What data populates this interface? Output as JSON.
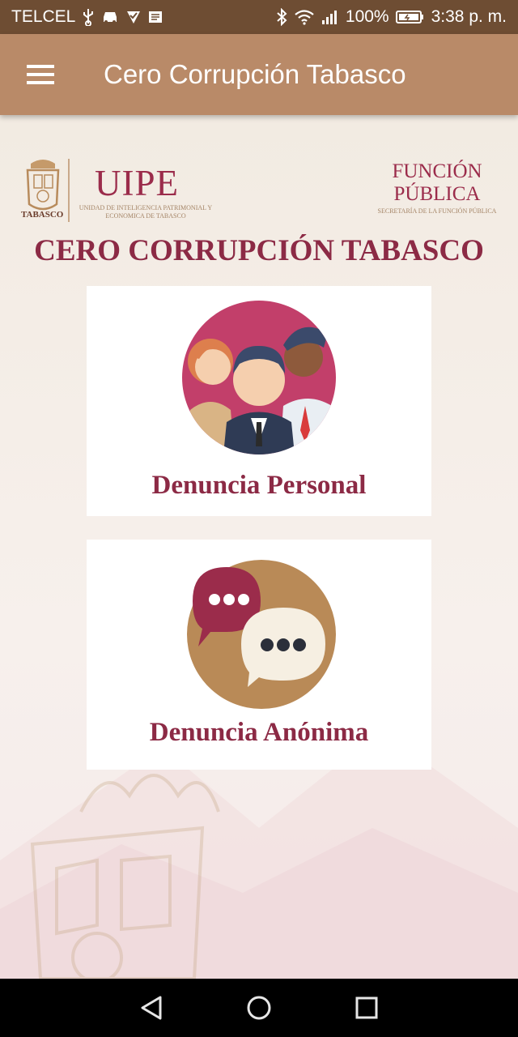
{
  "status_bar": {
    "carrier": "TELCEL",
    "battery": "100%",
    "time": "3:38 p. m.",
    "icons": [
      "usb-icon",
      "car-icon",
      "check-icon",
      "message-icon",
      "bluetooth-icon",
      "wifi-icon",
      "signal-icon",
      "battery-icon"
    ]
  },
  "app_bar": {
    "title": "Cero Corrupción Tabasco",
    "menu_icon": "hamburger-menu-icon",
    "background": "#b98a68"
  },
  "logos": {
    "tabasco": "TABASCO",
    "uipe": "UIPE",
    "uipe_subtitle": "UNIDAD DE INTELIGENCIA PATRIMONIAL Y ECONOMICA DE TABASCO",
    "funcion_publica": "FUNCIÓN PÚBLICA",
    "funcion_publica_subtitle": "SECRETARÍA DE LA FUNCIÓN PÚBLICA"
  },
  "headline": "CERO CORRUPCIÓN TABASCO",
  "cards": [
    {
      "label": "Denuncia Personal",
      "icon": "people-group-icon"
    },
    {
      "label": "Denuncia Anónima",
      "icon": "speech-bubbles-icon"
    }
  ],
  "nav_bar": {
    "buttons": [
      "back-triangle-icon",
      "home-circle-icon",
      "recents-square-icon"
    ]
  },
  "colors": {
    "accent": "#8c2a45",
    "status_bar": "#6e4d33",
    "background": "#f3ede4"
  }
}
